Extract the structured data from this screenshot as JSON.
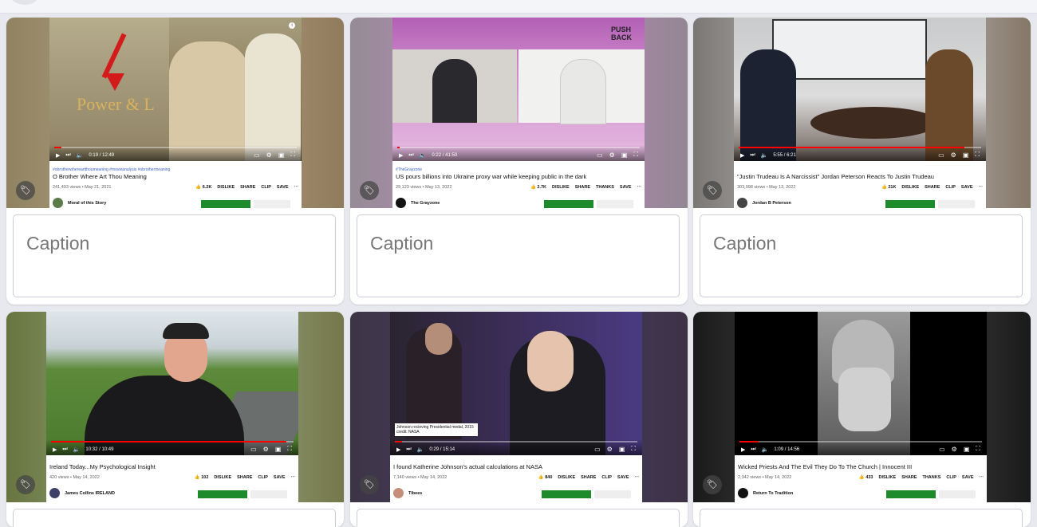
{
  "caption_placeholder": "Caption",
  "icons": {
    "tag": "tag-icon",
    "play": "play-icon",
    "next": "next-icon",
    "volume": "volume-icon",
    "settings": "gear-icon"
  },
  "cards": [
    {
      "hashtags": "#obrotherwhereartthoumeaning #movieanalysis #obrothermeaning",
      "title": "O Brother Where Art Thou Meaning",
      "views": "241,493 views • May 21, 2021",
      "likes": "6.2K",
      "actions": [
        "DISLIKE",
        "SHARE",
        "CLIP",
        "SAVE"
      ],
      "channel": "Moral of this Story",
      "time": "0:19 / 12:49",
      "overlay_text": "Power & L",
      "progress": 0.03
    },
    {
      "hashtags": "#TheGrayzone",
      "title": "US pours billions into Ukraine proxy war while keeping public in the dark",
      "views": "29,123 views • May 13, 2022",
      "likes": "2.7K",
      "actions": [
        "DISLIKE",
        "SHARE",
        "THANKS",
        "SAVE"
      ],
      "channel": "The Grayzone",
      "time": "0:22 / 41:50",
      "overlay_text": "PUSH BACK",
      "progress": 0.01
    },
    {
      "hashtags": "",
      "title": "\"Justin Trudeau Is A Narcissist\" Jordan Peterson Reacts To Justin Trudeau",
      "views": "303,998 views • May 13, 2022",
      "likes": "21K",
      "actions": [
        "DISLIKE",
        "SHARE",
        "CLIP",
        "SAVE"
      ],
      "channel": "Jordan B Peterson",
      "time": "5:55 / 6:21",
      "overlay_text": "",
      "progress": 0.93
    },
    {
      "hashtags": "",
      "title": "Ireland Today...My Psychological Insight",
      "views": "420 views • May 14, 2022",
      "likes": "102",
      "actions": [
        "DISLIKE",
        "SHARE",
        "CLIP",
        "SAVE"
      ],
      "channel": "James Collins IRELAND",
      "time": "10:32 / 10:49",
      "overlay_text": "",
      "progress": 0.97
    },
    {
      "hashtags": "",
      "title": "I found Katherine Johnson's actual calculations at NASA",
      "views": "7,140 views • May 14, 2022",
      "likes": "840",
      "actions": [
        "DISLIKE",
        "SHARE",
        "CLIP",
        "SAVE"
      ],
      "channel": "Tibees",
      "time": "0:29 / 15:14",
      "overlay_text": "Johnson recieving Presidential medal, 2015 credit: NASA",
      "progress": 0.03
    },
    {
      "hashtags": "",
      "title": "Wicked Priests And The Evil They Do To The Church | Innocent III",
      "views": "2,342 views • May 14, 2022",
      "likes": "433",
      "actions": [
        "DISLIKE",
        "SHARE",
        "THANKS",
        "CLIP",
        "SAVE"
      ],
      "channel": "Return To Tradition",
      "time": "1:09 / 14:56",
      "overlay_text": "",
      "progress": 0.08
    }
  ]
}
